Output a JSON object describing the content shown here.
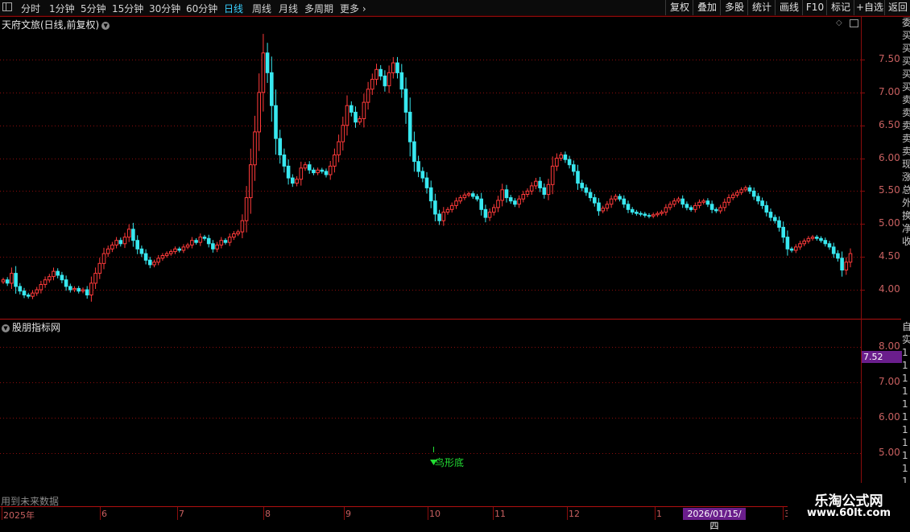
{
  "toolbar": {
    "periods": [
      {
        "label": "分时",
        "x": 26
      },
      {
        "label": "1分钟",
        "x": 61
      },
      {
        "label": "5分钟",
        "x": 100
      },
      {
        "label": "15分钟",
        "x": 139
      },
      {
        "label": "30分钟",
        "x": 185
      },
      {
        "label": "60分钟",
        "x": 231
      },
      {
        "label": "日线",
        "x": 278,
        "active": true
      },
      {
        "label": "周线",
        "x": 313
      },
      {
        "label": "月线",
        "x": 346
      },
      {
        "label": "多周期",
        "x": 378
      },
      {
        "label": "更多",
        "x": 422,
        "chevron": true
      }
    ],
    "actions": [
      "复权",
      "叠加",
      "多股",
      "统计",
      "画线",
      "F10",
      "标记",
      "+自选",
      "返回"
    ]
  },
  "main_panel": {
    "title": "天府文旅(日线,前复权)",
    "y_ticks": [
      "7.50",
      "7.00",
      "6.50",
      "6.00",
      "5.50",
      "5.00",
      "4.50",
      "4.00"
    ]
  },
  "indicator_panel": {
    "title": "股朋指标网",
    "y_ticks": [
      "8.00",
      "7.00",
      "6.00",
      "5.00"
    ],
    "value_box": "7.52",
    "signal_label": "鸟形底"
  },
  "x_axis": {
    "ticks": [
      "2025年",
      "6",
      "7",
      "8",
      "9",
      "10",
      "11",
      "12",
      "1",
      "3"
    ],
    "cursor_date": "2026/01/15/四"
  },
  "future_note": "用到未来数据",
  "watermark": {
    "line1": "乐淘公式网",
    "line2": "www.60lt.com"
  },
  "right_strip_glyphs": [
    "委",
    "买",
    "买",
    "买",
    "买",
    "买",
    "卖",
    "卖",
    "卖",
    "卖",
    "卖",
    "现",
    "涨",
    "总",
    "外",
    "换",
    "净",
    "收"
  ],
  "right_strip_glyphs2": [
    "自",
    "实",
    "1",
    "1",
    "1",
    "1",
    "1",
    "1",
    "1",
    "1",
    "1",
    "1",
    "1"
  ],
  "colors": {
    "up": "#ff3a3a",
    "down": "#38e8f0",
    "grid": "#8a0c0c",
    "axis_text": "#c86060",
    "accent": "#39d0ff",
    "signal": "#22dd33",
    "highlight": "#6a1e8c"
  },
  "chart_data": {
    "type": "candlestick",
    "title": "天府文旅(日线,前复权)",
    "ylim": [
      3.7,
      7.9
    ],
    "x_labels": [
      "2025年",
      "6",
      "7",
      "8",
      "9",
      "10",
      "11",
      "12",
      "1",
      "3"
    ],
    "ohlc_close": [
      4.15,
      4.1,
      4.25,
      4.05,
      3.98,
      3.92,
      3.9,
      3.95,
      4.0,
      4.08,
      4.15,
      4.2,
      4.28,
      4.22,
      4.15,
      4.05,
      4.0,
      4.02,
      3.98,
      4.0,
      3.92,
      4.1,
      4.25,
      4.4,
      4.55,
      4.62,
      4.68,
      4.75,
      4.7,
      4.8,
      4.92,
      4.75,
      4.62,
      4.55,
      4.45,
      4.38,
      4.42,
      4.48,
      4.52,
      4.55,
      4.58,
      4.62,
      4.6,
      4.65,
      4.68,
      4.75,
      4.72,
      4.8,
      4.78,
      4.7,
      4.62,
      4.68,
      4.75,
      4.72,
      4.8,
      4.85,
      4.88,
      5.05,
      5.4,
      5.9,
      6.4,
      7.0,
      7.6,
      7.3,
      6.8,
      6.3,
      6.05,
      5.88,
      5.7,
      5.62,
      5.68,
      5.85,
      5.9,
      5.82,
      5.78,
      5.82,
      5.8,
      5.75,
      5.88,
      6.05,
      6.25,
      6.5,
      6.8,
      6.7,
      6.55,
      6.6,
      6.85,
      7.05,
      7.2,
      7.35,
      7.25,
      7.1,
      7.3,
      7.45,
      7.3,
      7.05,
      6.7,
      6.25,
      5.95,
      5.8,
      5.7,
      5.55,
      5.35,
      5.15,
      5.05,
      5.18,
      5.22,
      5.28,
      5.35,
      5.4,
      5.44,
      5.46,
      5.42,
      5.38,
      5.22,
      5.1,
      5.18,
      5.25,
      5.36,
      5.52,
      5.4,
      5.35,
      5.3,
      5.38,
      5.45,
      5.5,
      5.58,
      5.65,
      5.55,
      5.45,
      5.6,
      5.88,
      6.0,
      6.05,
      5.98,
      5.9,
      5.8,
      5.62,
      5.55,
      5.48,
      5.4,
      5.32,
      5.2,
      5.24,
      5.3,
      5.38,
      5.42,
      5.38,
      5.3,
      5.22,
      5.18,
      5.16,
      5.15,
      5.13,
      5.12,
      5.14,
      5.16,
      5.18,
      5.25,
      5.3,
      5.35,
      5.38,
      5.3,
      5.25,
      5.22,
      5.28,
      5.33,
      5.35,
      5.3,
      5.22,
      5.2,
      5.25,
      5.33,
      5.4,
      5.44,
      5.48,
      5.52,
      5.55,
      5.5,
      5.42,
      5.35,
      5.28,
      5.18,
      5.1,
      5.05,
      4.95,
      4.8,
      4.62,
      4.6,
      4.65,
      4.7,
      4.74,
      4.78,
      4.8,
      4.78,
      4.75,
      4.7,
      4.65,
      4.55,
      4.48,
      4.3,
      4.42,
      4.55
    ]
  }
}
